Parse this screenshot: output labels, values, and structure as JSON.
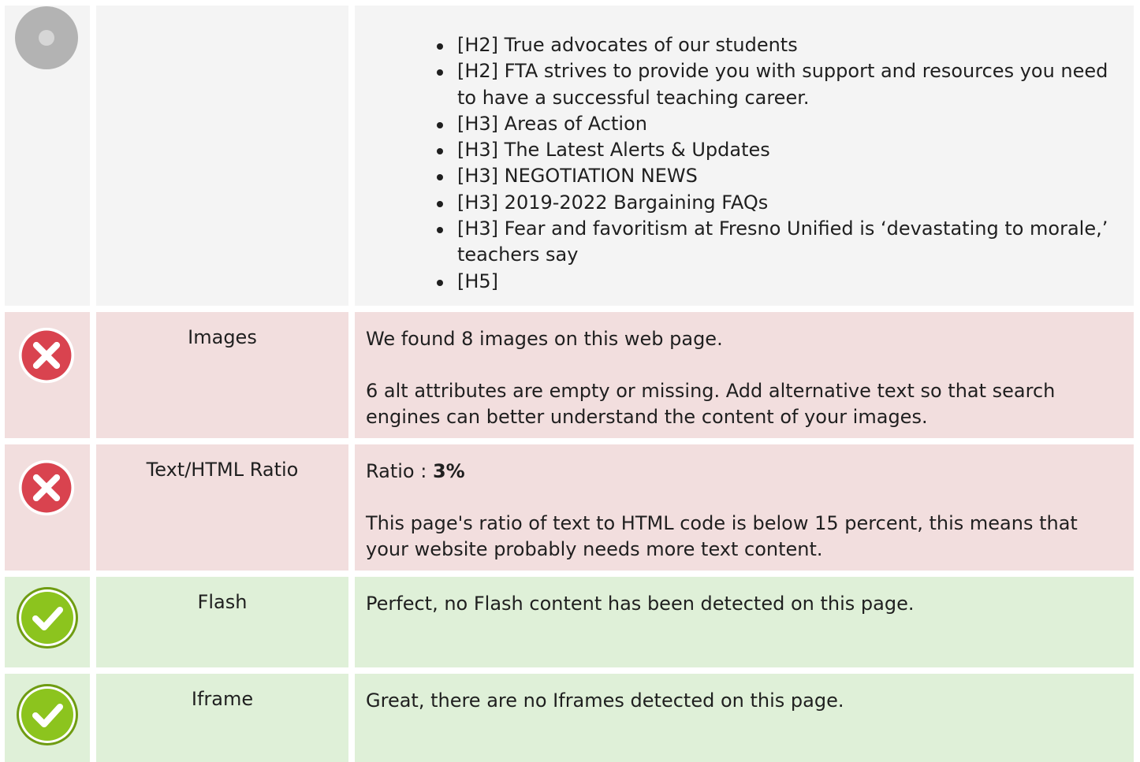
{
  "headings_row": {
    "icon": "neutral-gray-circle-icon",
    "label": "",
    "items": [
      "[H2] True advocates of our students",
      "[H2] FTA strives to provide you with support and resources you need to have a successful teaching career.",
      "[H3] Areas of Action",
      "[H3] The Latest Alerts & Updates",
      "[H3] NEGOTIATION NEWS",
      "[H3] 2019-2022 Bargaining FAQs",
      "[H3] Fear and favoritism at Fresno Unified is ‘devastating to morale,’ teachers say",
      "[H5]"
    ]
  },
  "images_row": {
    "status": "error",
    "icon": "error-x-icon",
    "label": "Images",
    "line1": "We found 8 images on this web page.",
    "line2": "6 alt attributes are empty or missing. Add alternative text so that search engines can better understand the content of your images."
  },
  "ratio_row": {
    "status": "error",
    "icon": "error-x-icon",
    "label": "Text/HTML Ratio",
    "ratio_prefix": "Ratio : ",
    "ratio_value": "3%",
    "line2": "This page's ratio of text to HTML code is below 15 percent, this means that your website probably needs more text content."
  },
  "flash_row": {
    "status": "ok",
    "icon": "check-icon",
    "label": "Flash",
    "line1": "Perfect, no Flash content has been detected on this page."
  },
  "iframe_row": {
    "status": "ok",
    "icon": "check-icon",
    "label": "Iframe",
    "line1": "Great, there are no Iframes detected on this page."
  },
  "colors": {
    "error_bg": "#f2dede",
    "ok_bg": "#dff0d8",
    "neutral_bg": "#f4f4f4",
    "error_icon": "#d9434f",
    "ok_icon": "#8cc41e"
  }
}
